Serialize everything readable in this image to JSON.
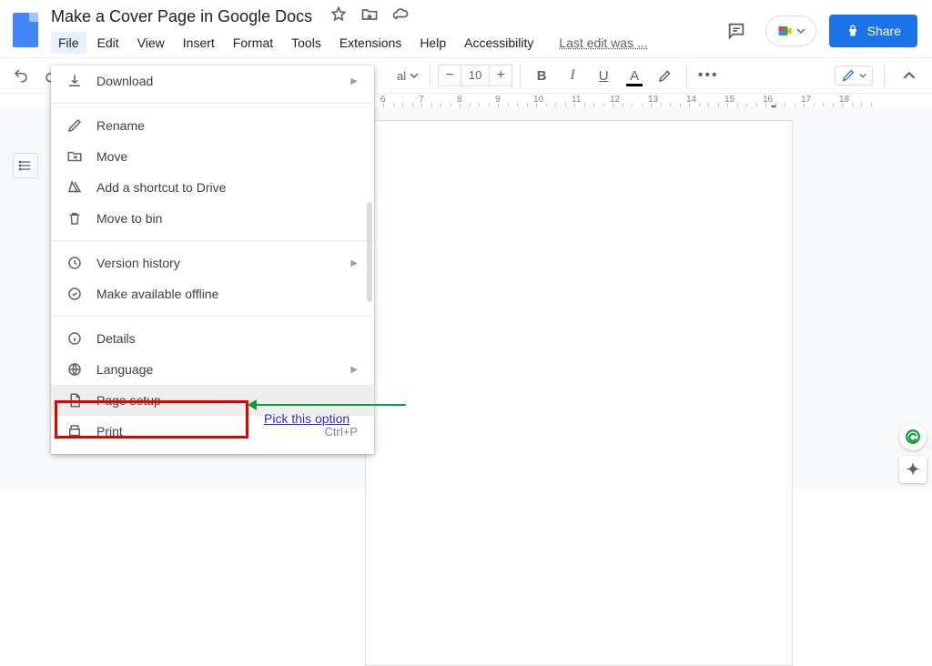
{
  "doc": {
    "title": "Make a Cover Page in Google Docs",
    "last_edit": "Last edit was ..."
  },
  "menubar": [
    "File",
    "Edit",
    "View",
    "Insert",
    "Format",
    "Tools",
    "Extensions",
    "Help",
    "Accessibility"
  ],
  "share": {
    "label": "Share"
  },
  "toolbar": {
    "font_partial": "al",
    "fontsize": "10"
  },
  "ruler": {
    "labels": [
      "6",
      "7",
      "8",
      "9",
      "10",
      "11",
      "12",
      "13",
      "14",
      "15",
      "16",
      "17",
      "18"
    ]
  },
  "filemenu": {
    "download": "Download",
    "rename": "Rename",
    "move": "Move",
    "shortcut": "Add a shortcut to Drive",
    "bin": "Move to bin",
    "version": "Version history",
    "offline": "Make available offline",
    "details": "Details",
    "language": "Language",
    "pagesetup": "Page setup",
    "print": "Print",
    "print_shortcut": "Ctrl+P"
  },
  "annotation": {
    "text": "Pick this option"
  }
}
